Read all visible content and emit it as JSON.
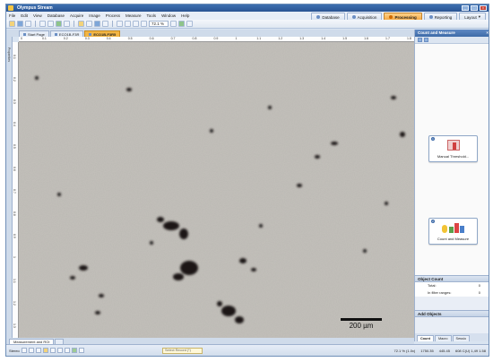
{
  "window": {
    "title": "Olympus Stream"
  },
  "menu": [
    "File",
    "Edit",
    "View",
    "Database",
    "Acquire",
    "Image",
    "Process",
    "Measure",
    "Tools",
    "Window",
    "Help"
  ],
  "workspaces": [
    {
      "label": "Database",
      "active": false
    },
    {
      "label": "Acquisition",
      "active": false
    },
    {
      "label": "Processing",
      "active": true
    },
    {
      "label": "Reporting",
      "active": false
    },
    {
      "label": "Layout",
      "active": false
    }
  ],
  "toolbar": {
    "zoom": "72.1 %"
  },
  "doc_tabs": [
    {
      "label": "Start Page",
      "active": false
    },
    {
      "label": "ECO1B-F3R",
      "active": false
    },
    {
      "label": "ECO1B-F3R5",
      "active": true
    }
  ],
  "left_strip": {
    "label": "Properties"
  },
  "ruler": {
    "top": [
      "0",
      "0.1",
      "0.2",
      "0.3",
      "0.4",
      "0.5",
      "0.6",
      "0.7",
      "0.8",
      "0.9",
      "1",
      "1.1",
      "1.2",
      "1.3",
      "1.4",
      "1.5",
      "1.6",
      "1.7",
      "1.8"
    ],
    "left": [
      "0.1",
      "0.2",
      "0.3",
      "0.4",
      "0.5",
      "0.6",
      "0.7",
      "0.8",
      "0.9",
      "1",
      "1.1",
      "1.2",
      "1.3"
    ]
  },
  "image": {
    "scale_bar": "200 µm"
  },
  "panel": {
    "title": "Count and Measure",
    "cards": [
      {
        "num": "1",
        "label": "Manual Threshold..."
      },
      {
        "num": "2",
        "label": "Count and Measure"
      }
    ],
    "object_count": {
      "title": "Object Count",
      "rows": [
        {
          "label": "Total:",
          "value": "0"
        },
        {
          "label": "In filter ranges:",
          "value": "0"
        }
      ]
    },
    "add_objects": {
      "title": "Add Objects"
    },
    "bottom_tabs": [
      {
        "label": "Count",
        "active": true
      },
      {
        "label": "Macro",
        "active": false
      },
      {
        "label": "Sessio",
        "active": false
      }
    ]
  },
  "bottom_tabs": [
    {
      "label": "Measurement and ROI",
      "active": true
    },
    {
      "label": "",
      "active": false
    }
  ],
  "status": {
    "left_label": "Stereo",
    "combo": "Select Record (*)",
    "zoom": "72.1 % (1.0x)",
    "coords": "1750.35",
    "value": "445.45",
    "info": "608 C(U) 1,49 1.58"
  },
  "colors": {
    "accent": "#f2b544",
    "title": "#2a5493",
    "image_bg": "#c6c3bd"
  }
}
